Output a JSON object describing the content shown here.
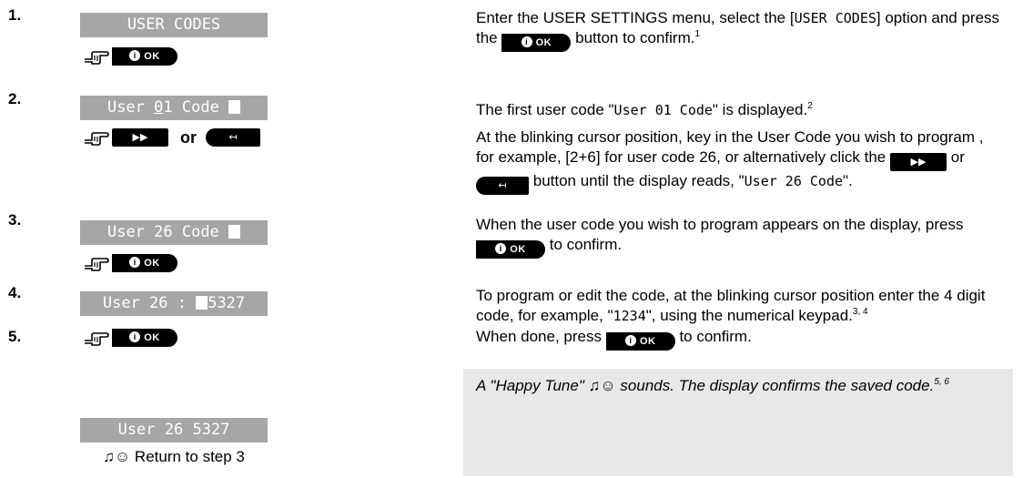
{
  "buttons": {
    "ok": "OK",
    "ok_info": "i"
  },
  "steps": [
    {
      "num": "1.",
      "display": "USER CODES",
      "text_pre": "Enter the USER SETTINGS menu, select the [",
      "text_mono": "USER CODES",
      "text_mid": "] option and press the",
      "text_post": "button to confirm.",
      "fn": "1"
    },
    {
      "num": "2.",
      "display_a": "User ",
      "display_b": "0",
      "display_c": "1 Code ",
      "or_label": "or",
      "text1_pre": "The first user code \"",
      "text1_mono": "User 01 Code",
      "text1_post": "\" is displayed.",
      "fn1": "2",
      "text2_pre": "At the blinking cursor position, key in the User Code you wish to program , for example, [2+6] for user code 26, or alternatively click the",
      "text2_or": "or",
      "text2_mid": "button until the display reads, \"",
      "text2_mono": "User 26 Code",
      "text2_end": "\"."
    },
    {
      "num": "3.",
      "display": "User 26 Code ",
      "text_pre": "When the user code you wish to program appears on the display, press",
      "text_post": "to confirm."
    },
    {
      "num": "4.",
      "display_a": "User 26 : ",
      "display_b": "5327",
      "text_pre": "To program or edit the code, at the blinking cursor position enter the 4 digit code, for example, \"",
      "text_mono": "1234",
      "text_post": "\", using the numerical keypad.",
      "fn": "3, 4"
    },
    {
      "num": "5.",
      "text_pre": "When done, press",
      "text_post": "to confirm."
    }
  ],
  "result": {
    "display": "User 26 5327",
    "return_label": "♫☺ Return to step 3",
    "note": "A \"Happy Tune\" ♫☺ sounds. The display confirms the saved code.",
    "fn": "5, 6"
  }
}
